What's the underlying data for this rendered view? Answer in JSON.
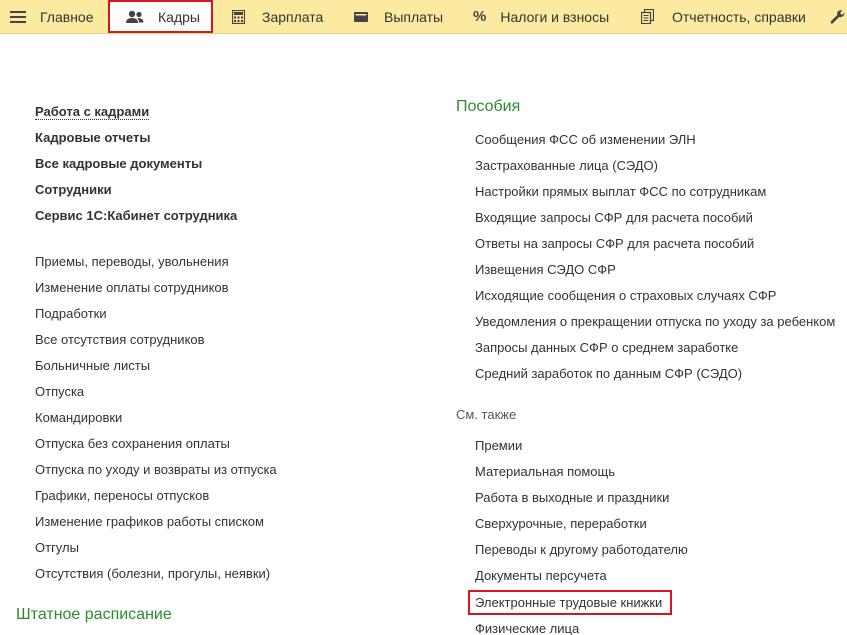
{
  "topbar": {
    "items": [
      {
        "label": "Главное",
        "icon": "menu-icon"
      },
      {
        "label": "Кадры",
        "icon": "users-icon"
      },
      {
        "label": "Зарплата",
        "icon": "calculator-icon"
      },
      {
        "label": "Выплаты",
        "icon": "wallet-icon"
      },
      {
        "label": "Налоги и взносы",
        "icon": "percent-icon"
      },
      {
        "label": "Отчетность, справки",
        "icon": "documents-icon"
      },
      {
        "label": "",
        "icon": "wrench-icon"
      }
    ],
    "active": "Кадры"
  },
  "left": {
    "main_links": [
      "Работа с кадрами",
      "Кадровые отчеты",
      "Все кадровые документы",
      "Сотрудники",
      "Сервис 1С:Кабинет сотрудника"
    ],
    "doc_links": [
      "Приемы, переводы, увольнения",
      "Изменение оплаты сотрудников",
      "Подработки",
      "Все отсутствия сотрудников",
      "Больничные листы",
      "Отпуска",
      "Командировки",
      "Отпуска без сохранения оплаты",
      "Отпуска по уходу и возвраты из отпуска",
      "Графики, переносы отпусков",
      "Изменение графиков работы списком",
      "Отгулы",
      "Отсутствия (болезни, прогулы, неявки)"
    ],
    "staff_title": "Штатное расписание"
  },
  "right": {
    "benefits_title": "Пособия",
    "benefits_links": [
      "Сообщения ФСС об изменении ЭЛН",
      "Застрахованные лица (СЭДО)",
      "Настройки прямых выплат ФСС по сотрудникам",
      "Входящие запросы СФР для расчета пособий",
      "Ответы на запросы СФР для расчета пособий",
      "Извещения СЭДО СФР",
      "Исходящие сообщения о страховых случаях СФР",
      "Уведомления о прекращении отпуска по уходу за ребенком",
      "Запросы данных СФР о среднем заработке",
      "Средний заработок по данным СФР (СЭДО)"
    ],
    "see_also_title": "См. также",
    "see_also_links": [
      "Премии",
      "Материальная помощь",
      "Работа в выходные и праздники",
      "Сверхурочные, переработки",
      "Переводы к другому работодателю",
      "Документы персучета",
      "Электронные трудовые книжки",
      "Физические лица"
    ]
  },
  "colors": {
    "topbar_bg": "#fbeaa0",
    "highlight_border": "#d6171f",
    "group_title": "#2e8b2e",
    "text": "#333333"
  }
}
